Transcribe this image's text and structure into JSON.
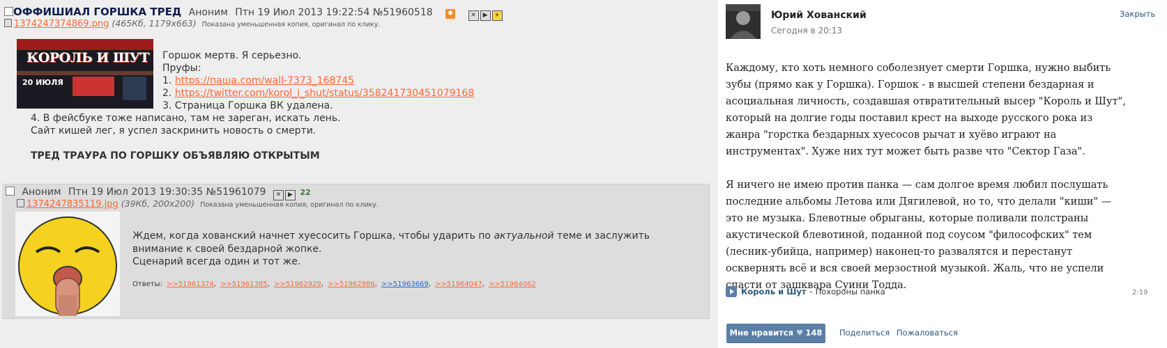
{
  "op": {
    "title": "ОФФИШИАЛ ГОРШКА ТРЕД",
    "author": "Аноним",
    "datetime": "Птн 19 Июл 2013 19:22:54",
    "number": "№51960518",
    "file": {
      "name": "1374247374869.png",
      "meta": "(465Кб, 1179x663)",
      "note": "Показана уменьшенная копия, оригинал по клику."
    },
    "thumb": {
      "logo": "КОРОЛЬ И ШУТ",
      "date": "20 ИЮЛЯ"
    },
    "lines": [
      "Горшок мертв. Я серьезно.",
      "Пруфы:",
      "1. ",
      "2. ",
      "3. Страница Горшка ВК удалена.",
      "4. В фейсбуке тоже написано, там не зареган, искать лень.",
      "Сайт кишей лег, я успел заскринить новость о смерти."
    ],
    "link1": "https://пaшa.com/wall-7373_168745",
    "link2": "https://twitter.com/korol_i_shut/status/358241730451079168",
    "bold": "ТРЕД ТРАУРА ПО ГОРШКУ ОБЪЯВЛЯЮ ОТКРЫТЫМ"
  },
  "reply": {
    "author": "Аноним",
    "datetime": "Птн 19 Июл 2013 19:30:35",
    "number": "№51961079",
    "count": "22",
    "file": {
      "name": "1374247835119.jpg",
      "meta": "(39Кб, 200x200)",
      "note": "Показана уменьшенная копия, оригинал по клику."
    },
    "text_a": "Ждем, когда хованский начнет хуесосить Горшка, чтобы ударить по ",
    "text_em": "актуальной",
    "text_b": " теме и заслужить внимание к своей бездарной жопке.",
    "text_c": "Сценарий всегда один и тот же.",
    "answers_label": "Ответы:",
    "answers": [
      ">>51961374",
      ">>51961385",
      ">>51962929",
      ">>51962986",
      ">>51963669",
      ">>51964047",
      ">>51964062"
    ]
  },
  "vk": {
    "name": "Юрий Хованский",
    "time": "Сегодня в 20:13",
    "close": "Закрыть",
    "para1": "Каждому, кто хоть немного соболезнует смерти Горшка, нужно выбить зубы (прямо как у Горшка). Горшок - в высшей степени бездарная и асоциальная личность, создавшая отвратительный высер \"Король и Шут\", который на долгие годы поставил крест на выходе русского рока из жанра \"горстка бездарных хуесосов рычат и хуёво играют на инструментах\". Хуже них тут может быть разве что \"Сектор Газа\".",
    "para2": "Я ничего не имею против панка — сам долгое время любил послушать последние альбомы Летова или Дягилевой, но то, что делали \"киши\" — это не музыка. Блевотные обрыганы, которые поливали полстраны акустической блевотиной, поданной под соусом \"философских\" тем (лесник-убийца, например) наконец-то развалятся и перестанут осквернять всё и вся своей мерзостной музыкой. Жаль, что не успели спасти от зашквара Суини Тодда.",
    "audio_artist": "Король и Шут",
    "audio_sep": " – ",
    "audio_title": "Похороны панка",
    "audio_duration": "2:19",
    "like_label": "Мне нравится",
    "like_count": "148",
    "share": "Поделиться",
    "report": "Пожаловаться"
  }
}
